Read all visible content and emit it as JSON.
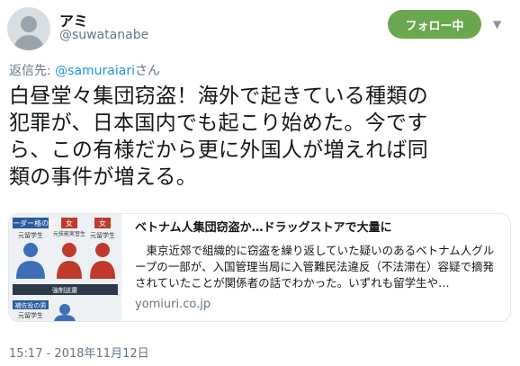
{
  "author": {
    "name": "アミ",
    "handle": "@suwatanabe"
  },
  "follow_button": {
    "label": "フォロー中"
  },
  "reply": {
    "prefix": "返信先: ",
    "mention": "@samuraiari",
    "suffix": "さん"
  },
  "tweet": {
    "text_lines": [
      "白昼堂々集団窃盗！海外で起きている種類の",
      "犯罪が、日本国内でも起こり始めた。今です",
      "ら、この有様だから更に外国人が増えれば同",
      "類の事件が増える。"
    ]
  },
  "card": {
    "title": "ベトナム人集団窃盗か…ドラッグストアで大量に",
    "description": "　東京近郊で組織的に窃盗を繰り返していた疑いのあるベトナム人グループの一部が、入国管理当局に入管難民法違反（不法滞在）容疑で摘発されていたことが関係者の話でわかった。いずれも留学生や…",
    "domain": "yomiuri.co.jp",
    "thumbnail": {
      "leader_label": "リーダー格の男",
      "leader_sub": "元留学生",
      "woman1_label": "女",
      "woman1_sub": "元技能実習生",
      "woman2_label": "女",
      "woman2_sub": "元留学生",
      "deport_label": "強制送還",
      "aide_label": "補佐役の男",
      "aide_sub": "元留学生"
    }
  },
  "timestamp": "15:17 - 2018年11月12日",
  "colors": {
    "follow_button_bg": "#6aa84f",
    "mention": "#1b95e0",
    "secondary_text": "#657786"
  }
}
